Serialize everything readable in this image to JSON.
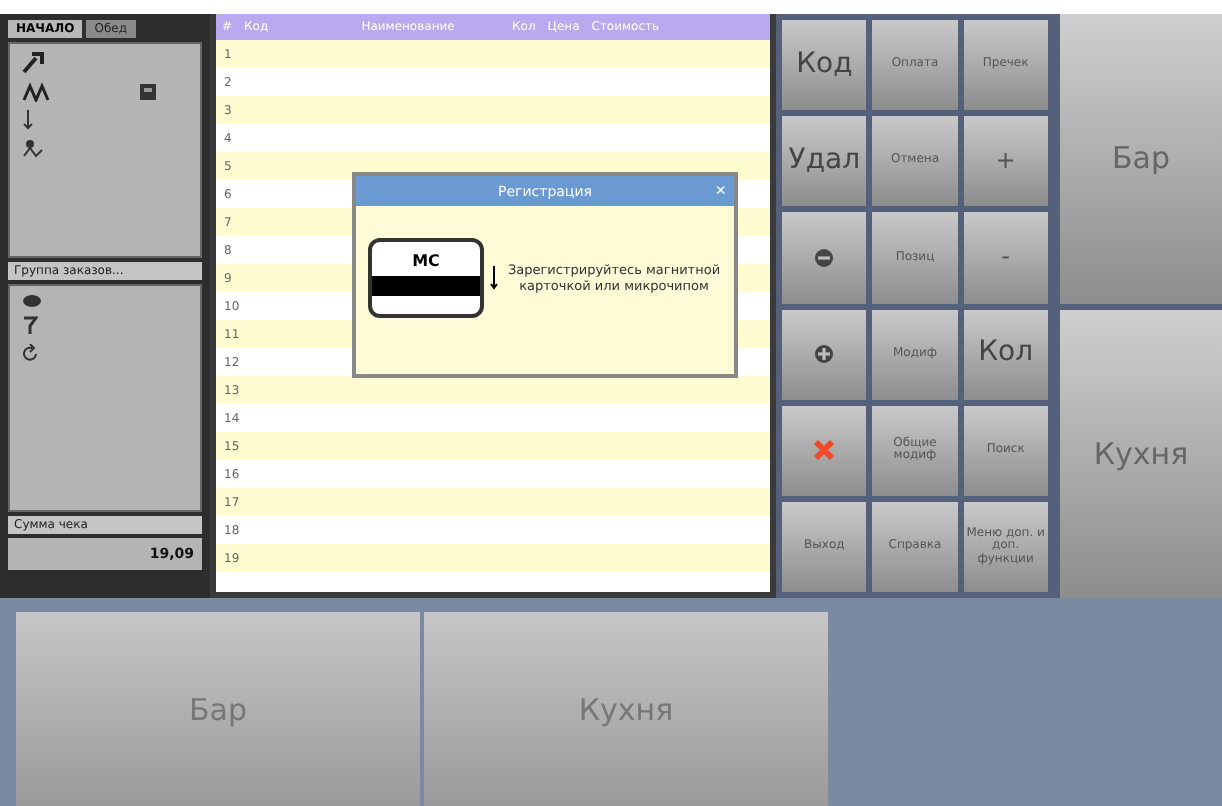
{
  "left_panel": {
    "tabs": [
      {
        "label": "НАЧАЛО",
        "selected": true
      },
      {
        "label": "Обед",
        "selected": false
      }
    ],
    "section_label": "Группа заказов...",
    "total_label": "Сумма чека",
    "total_value": "19,09"
  },
  "table": {
    "columns": [
      "#",
      "Код",
      "Наименование",
      "Кол",
      "Цена",
      "Стоимость"
    ],
    "rows": [
      "1",
      "2",
      "3",
      "4",
      "5",
      "6",
      "7",
      "8",
      "9",
      "10",
      "11",
      "12",
      "13",
      "14",
      "15",
      "16",
      "17",
      "18",
      "19"
    ]
  },
  "dialog": {
    "title": "Регистрация",
    "close": "×",
    "card_label": "MC",
    "message": "Зарегистрируйтесь магнитной карточкой или микрочипом"
  },
  "keypad": [
    {
      "label": "Код",
      "kind": "large"
    },
    {
      "label": "Оплата",
      "kind": "small"
    },
    {
      "label": "Пречек",
      "kind": "small"
    },
    {
      "label": "Удал",
      "kind": "large"
    },
    {
      "label": "Отмена",
      "kind": "small"
    },
    {
      "label": "+",
      "kind": "medium"
    },
    {
      "kind": "minus-icon"
    },
    {
      "label": "Позиц",
      "kind": "small"
    },
    {
      "label": "-",
      "kind": "medium"
    },
    {
      "kind": "plus-icon"
    },
    {
      "label": "Модиф",
      "kind": "small"
    },
    {
      "label": "Кол",
      "kind": "large"
    },
    {
      "kind": "cross-icon"
    },
    {
      "label": "Общие модиф",
      "kind": "small"
    },
    {
      "label": "Поиск",
      "kind": "small"
    },
    {
      "label": "Выход",
      "kind": "small"
    },
    {
      "label": "Справка",
      "kind": "small"
    },
    {
      "label": "Меню доп. и доп. функции",
      "kind": "small"
    }
  ],
  "side_buttons": [
    "Бар",
    "Кухня"
  ],
  "bottom_buttons": [
    "Бар",
    "Кухня"
  ]
}
